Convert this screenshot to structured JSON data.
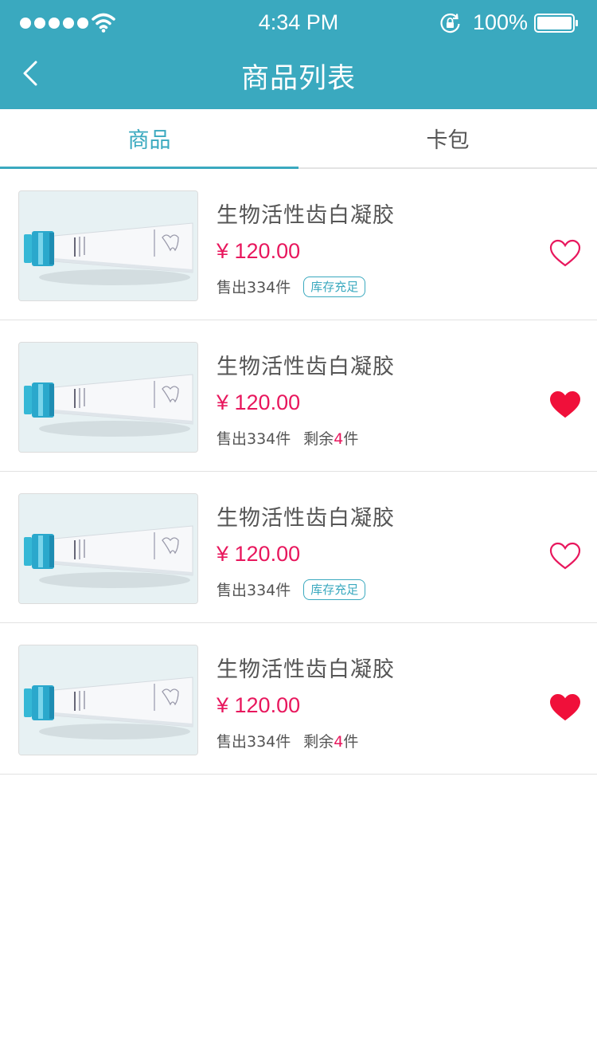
{
  "status_bar": {
    "time": "4:34 PM",
    "battery_percent": "100%",
    "signal_icon": "signal-dots-icon",
    "wifi_icon": "wifi-icon",
    "rotation_lock_icon": "rotation-lock-icon",
    "battery_icon": "battery-icon"
  },
  "nav": {
    "title": "商品列表",
    "back_icon": "chevron-left-icon"
  },
  "tabs": [
    {
      "label": "商品",
      "active": true
    },
    {
      "label": "卡包",
      "active": false
    }
  ],
  "colors": {
    "brand": "#3aa9bf",
    "price": "#e8175d",
    "favorite": "#f0103a"
  },
  "products": [
    {
      "name": "生物活性齿白凝胶",
      "price": "¥ 120.00",
      "sold": "售出334件",
      "stock_badge": "库存充足",
      "favorited": false
    },
    {
      "name": "生物活性齿白凝胶",
      "price": "¥ 120.00",
      "sold": "售出334件",
      "remain_prefix": "剩余",
      "remain_count": "4",
      "remain_suffix": "件",
      "favorited": true
    },
    {
      "name": "生物活性齿白凝胶",
      "price": "¥ 120.00",
      "sold": "售出334件",
      "stock_badge": "库存充足",
      "favorited": false
    },
    {
      "name": "生物活性齿白凝胶",
      "price": "¥ 120.00",
      "sold": "售出334件",
      "remain_prefix": "剩余",
      "remain_count": "4",
      "remain_suffix": "件",
      "favorited": true
    }
  ]
}
